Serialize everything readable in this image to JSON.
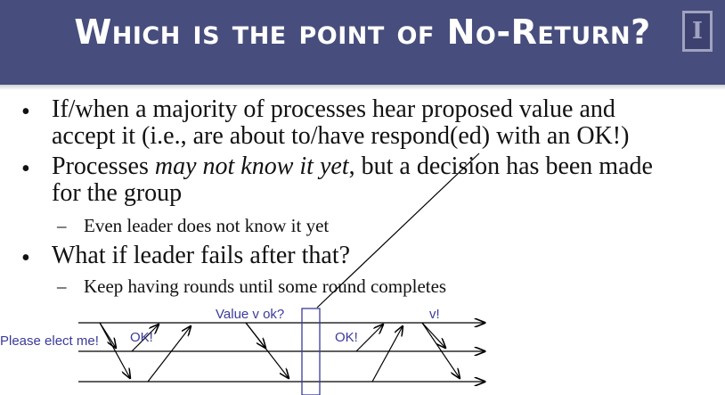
{
  "title": "Which is the point of No-Return?",
  "logo_letter": "I",
  "bullets": [
    {
      "line1": "If/when a majority of processes hear proposed value and",
      "line2": "accept it (i.e., are about to/have respond(ed) with an OK!)"
    },
    {
      "line1_pre": "Processes ",
      "line1_em": "may not know it yet",
      "line1_post": ", but a decision has been made",
      "line2": "for the group"
    },
    {
      "line1": "What if leader fails after that?"
    }
  ],
  "sub_bullets": [
    "Even leader does not know it yet",
    "Keep having rounds until some round completes"
  ],
  "bullet_char": "•",
  "dash_char": "–",
  "diagram": {
    "label_elect": "Please elect me!",
    "label_ok_1": "OK!",
    "label_value": "Value v ok?",
    "label_ok_2": "OK!",
    "label_v": "v!"
  },
  "colors": {
    "title_bg": "#474d7c",
    "diagram_line": "#000000",
    "diagram_box": "#3a3a9a"
  }
}
